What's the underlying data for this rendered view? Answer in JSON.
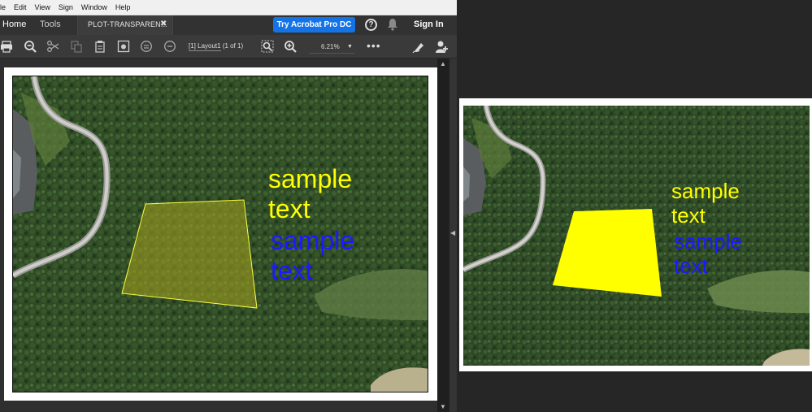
{
  "menu": {
    "items": [
      "ile",
      "Edit",
      "View",
      "Sign",
      "Window",
      "Help"
    ]
  },
  "tabs": {
    "home": "Home",
    "tools": "Tools",
    "document": "PLOT-TRANSPAREN...",
    "close_glyph": "✖"
  },
  "header": {
    "try_button": "Try Acrobat Pro DC",
    "help_glyph": "?",
    "sign_in": "Sign In"
  },
  "toolbar": {
    "page_layout": "[1] Layout1",
    "page_count": "(1 of 1)",
    "zoom": "6.21%",
    "zoom_caret": "▼",
    "more": "•••"
  },
  "scroll": {
    "up_glyph": "▲",
    "down_glyph": "▼",
    "split_glyph": "◀"
  },
  "plot": {
    "yellow_text_line1": "sample",
    "yellow_text_line2": "text",
    "blue_text_line1": "sample",
    "blue_text_line2": "text",
    "yellow_color": "#ffff00",
    "blue_color": "#1a1aff",
    "polygon_left_fill": "#9a9a1e",
    "polygon_right_fill": "#ffff00"
  },
  "preview": {
    "yellow_text_line1": "sample",
    "yellow_text_line2": "text",
    "blue_text_line1": "sample",
    "blue_text_line2": "text"
  }
}
